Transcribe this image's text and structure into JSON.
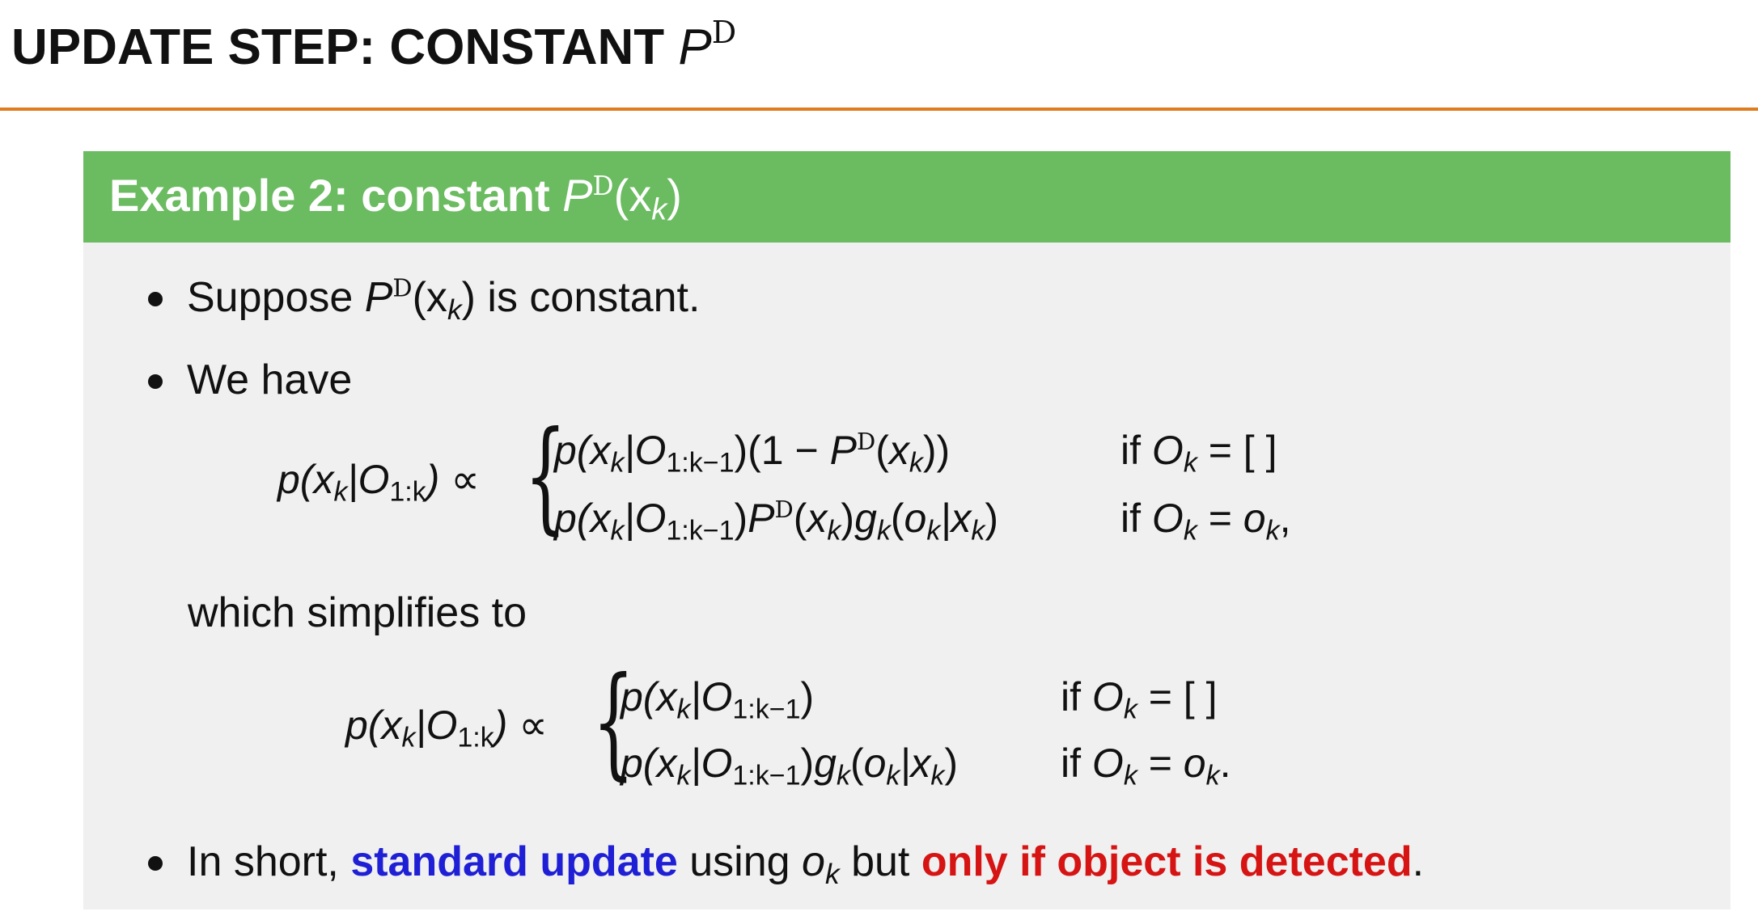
{
  "header": {
    "title_text": "UPDATE STEP: CONSTANT ",
    "title_sym": "P",
    "title_sup": "D"
  },
  "block": {
    "header_text": "Example 2: constant ",
    "header_sym": "P",
    "header_sup": "D",
    "header_arg": "(x",
    "header_sub": "k",
    "header_close": ")"
  },
  "bullets": {
    "b1_prefix": "Suppose ",
    "b1_sym": "P",
    "b1_sup": "D",
    "b1_arg": "(x",
    "b1_sub": "k",
    "b1_close": ")",
    "b1_suffix": " is constant.",
    "b2_text": "We have",
    "mid_text": "which simplifies to",
    "b3_prefix": "In short, ",
    "b3_blue": "standard update",
    "b3_mid": " using ",
    "b3_sym": "o",
    "b3_sub": "k",
    "b3_but": " but ",
    "b3_red": "only if object is detected",
    "b3_end": "."
  },
  "eq1": {
    "lhs": "p(x_k | O_{1:k}) ∝",
    "case1": "p(x_k | O_{1:k−1})(1 − P^D(x_k))",
    "cond1": "if O_k = [ ]",
    "case2": "p(x_k | O_{1:k−1}) P^D(x_k) g_k(o_k | x_k)",
    "cond2": "if O_k = o_k,"
  },
  "eq2": {
    "lhs": "p(x_k | O_{1:k}) ∝",
    "case1": "p(x_k | O_{1:k−1})",
    "cond1": "if O_k = [ ]",
    "case2": "p(x_k | O_{1:k−1}) g_k(o_k | x_k)",
    "cond2": "if O_k = o_k."
  },
  "colors": {
    "rule": "#e07b1e",
    "block_header": "#6bbb61",
    "block_body": "#f0f0f0",
    "highlight_blue": "#1f1fd6",
    "highlight_red": "#d61414"
  }
}
